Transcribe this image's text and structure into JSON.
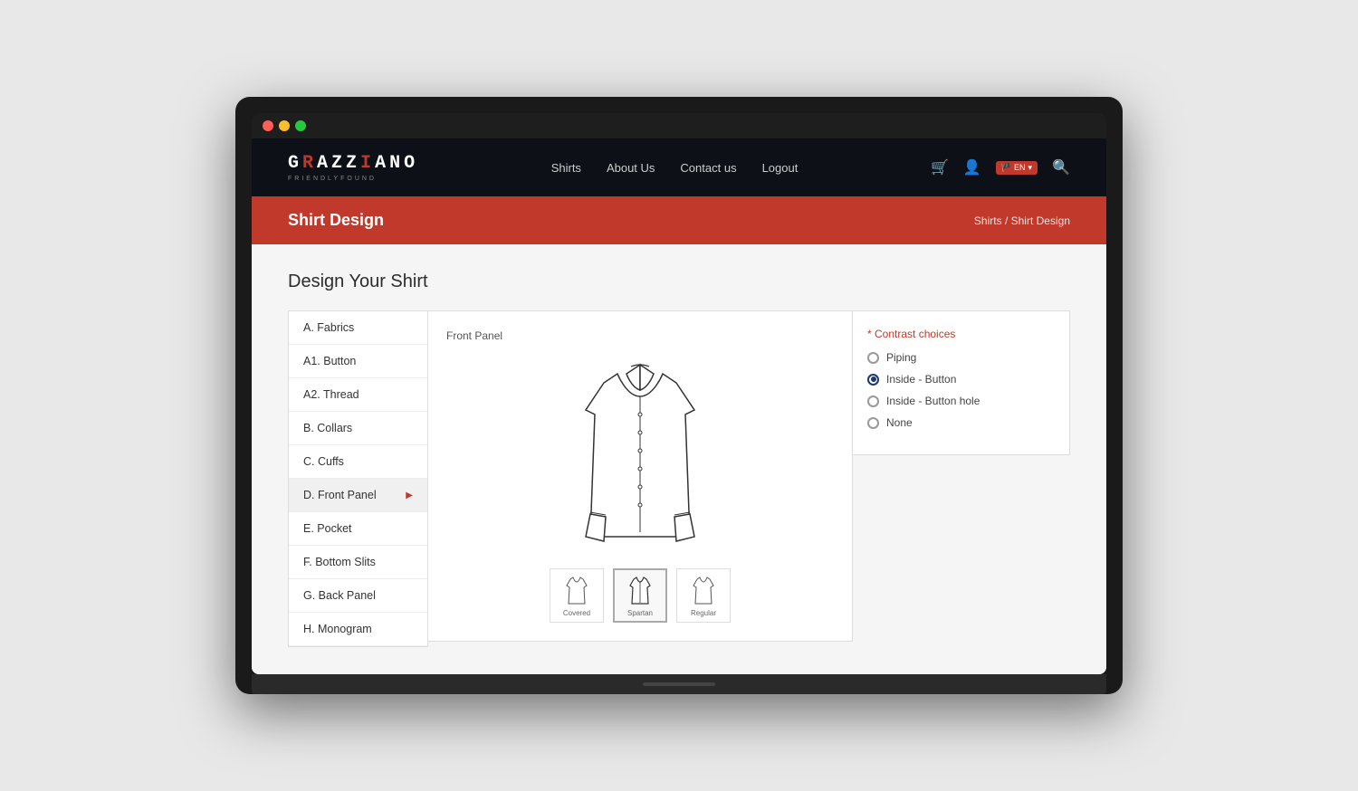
{
  "laptop": {
    "traffic_lights": [
      "red",
      "yellow",
      "green"
    ]
  },
  "navbar": {
    "logo_letters": "GRAZZIANO",
    "logo_tagline": "FRIENDLYFOUND",
    "links": [
      {
        "label": "Shirts",
        "id": "shirts"
      },
      {
        "label": "About Us",
        "id": "about"
      },
      {
        "label": "Contact us",
        "id": "contact"
      },
      {
        "label": "Logout",
        "id": "logout"
      }
    ],
    "flag_label": "EN"
  },
  "page_header": {
    "title": "Shirt Design",
    "breadcrumb_home": "Shirts",
    "breadcrumb_separator": " / ",
    "breadcrumb_current": "Shirt Design"
  },
  "main": {
    "section_title": "Design Your Shirt",
    "sidebar_items": [
      {
        "label": "A. Fabrics",
        "id": "fabrics",
        "arrow": false
      },
      {
        "label": "A1. Button",
        "id": "button",
        "arrow": false
      },
      {
        "label": "A2. Thread",
        "id": "thread",
        "arrow": false
      },
      {
        "label": "B. Collars",
        "id": "collars",
        "arrow": false
      },
      {
        "label": "C. Cuffs",
        "id": "cuffs",
        "arrow": false
      },
      {
        "label": "D. Front Panel",
        "id": "front-panel",
        "arrow": true
      },
      {
        "label": "E. Pocket",
        "id": "pocket",
        "arrow": false
      },
      {
        "label": "F. Bottom Slits",
        "id": "bottom-slits",
        "arrow": false
      },
      {
        "label": "G. Back Panel",
        "id": "back-panel",
        "arrow": false
      },
      {
        "label": "H. Monogram",
        "id": "monogram",
        "arrow": false
      }
    ],
    "center_panel_label": "Front Panel",
    "thumbnails": [
      {
        "label": "Covered",
        "selected": false
      },
      {
        "label": "Spartan",
        "selected": true
      },
      {
        "label": "Regular",
        "selected": false
      }
    ],
    "contrast": {
      "title": "Contrast choices",
      "required": "*",
      "options": [
        {
          "label": "Piping",
          "checked": false
        },
        {
          "label": "Inside - Button",
          "checked": true
        },
        {
          "label": "Inside - Button hole",
          "checked": false
        },
        {
          "label": "None",
          "checked": false
        }
      ]
    }
  }
}
